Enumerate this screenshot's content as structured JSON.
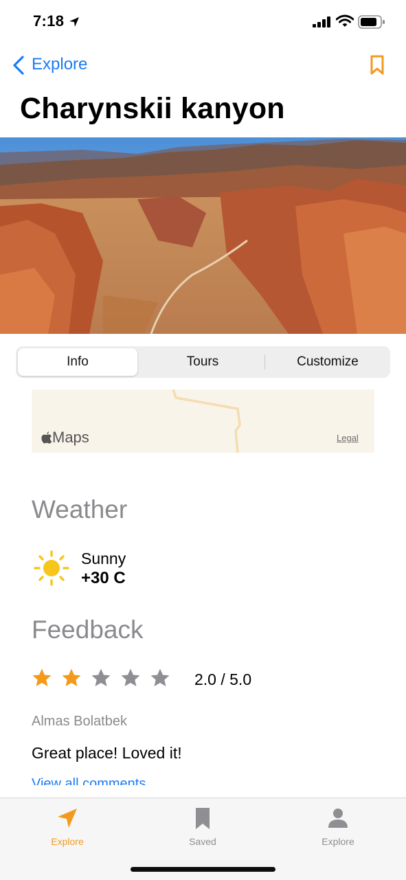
{
  "status_bar": {
    "time": "7:18"
  },
  "nav": {
    "back_label": "Explore"
  },
  "page": {
    "title": "Charynskii kanyon"
  },
  "tabs": [
    {
      "label": "Info",
      "active": true
    },
    {
      "label": "Tours",
      "active": false
    },
    {
      "label": "Customize",
      "active": false
    }
  ],
  "map": {
    "brand": "Maps",
    "legal": "Legal"
  },
  "weather": {
    "title": "Weather",
    "condition": "Sunny",
    "temperature": "+30 C"
  },
  "feedback": {
    "title": "Feedback",
    "rating": 2.0,
    "max_rating": 5,
    "rating_text": "2.0 / 5.0",
    "review": {
      "author": "Almas Bolatbek",
      "text": "Great place! Loved it!"
    },
    "view_all": "View all comments"
  },
  "tab_bar": {
    "items": [
      {
        "label": "Explore",
        "icon": "location-arrow-icon",
        "active": true
      },
      {
        "label": "Saved",
        "icon": "bookmark-icon",
        "active": false
      },
      {
        "label": "Explore",
        "icon": "person-icon",
        "active": false
      }
    ]
  },
  "colors": {
    "accent": "#f39a1c",
    "link": "#1a7bf2",
    "secondary_text": "#8a8a8e",
    "star_inactive": "#8e8e93"
  }
}
